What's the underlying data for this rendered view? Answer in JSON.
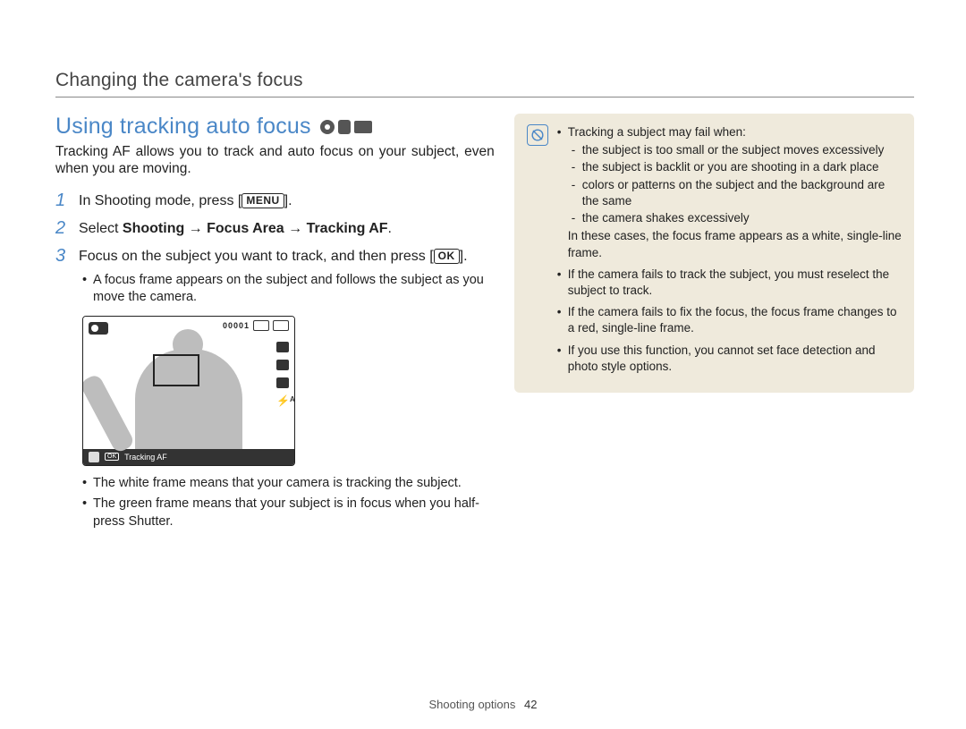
{
  "header": {
    "title": "Changing the camera's focus"
  },
  "section": {
    "title": "Using tracking auto focus",
    "intro": "Tracking AF allows you to track and auto focus on your subject, even when you are moving."
  },
  "steps": {
    "s1_pre": "In Shooting mode, press [",
    "s1_btn": "MENU",
    "s1_post": "].",
    "s2_pre": "Select ",
    "s2_bold": "Shooting → Focus Area → Tracking AF",
    "s2_post": ".",
    "s3": "Focus on the subject you want to track, and then press [",
    "s3_btn": "OK",
    "s3_post": "]."
  },
  "sub_points": {
    "a": "A focus frame appears on the subject and follows the subject as you move the camera.",
    "b": "The white frame means that your camera is tracking the subject.",
    "c_pre": "The green frame means that your subject is in focus when you half-press ",
    "c_bold": "Shutter",
    "c_post": "."
  },
  "camera_illustration": {
    "counter": "00001",
    "bottom_ok": "OK",
    "bottom_label": "Tracking AF"
  },
  "note": {
    "b1": "Tracking a subject may fail when:",
    "d1": "the subject is too small or the subject moves excessively",
    "d2": "the subject is backlit or you are shooting in a dark place",
    "d3": "colors or patterns on the subject and the background are the same",
    "d4": "the camera shakes excessively",
    "b1_tail": "In these cases, the focus frame appears as a white, single-line frame.",
    "b2": "If the camera fails to track the subject, you must reselect the subject to track.",
    "b3": "If the camera fails to fix the focus, the focus frame changes to a red, single-line frame.",
    "b4": "If you use this function, you cannot set face detection and photo style options."
  },
  "footer": {
    "section": "Shooting options",
    "page": "42"
  }
}
